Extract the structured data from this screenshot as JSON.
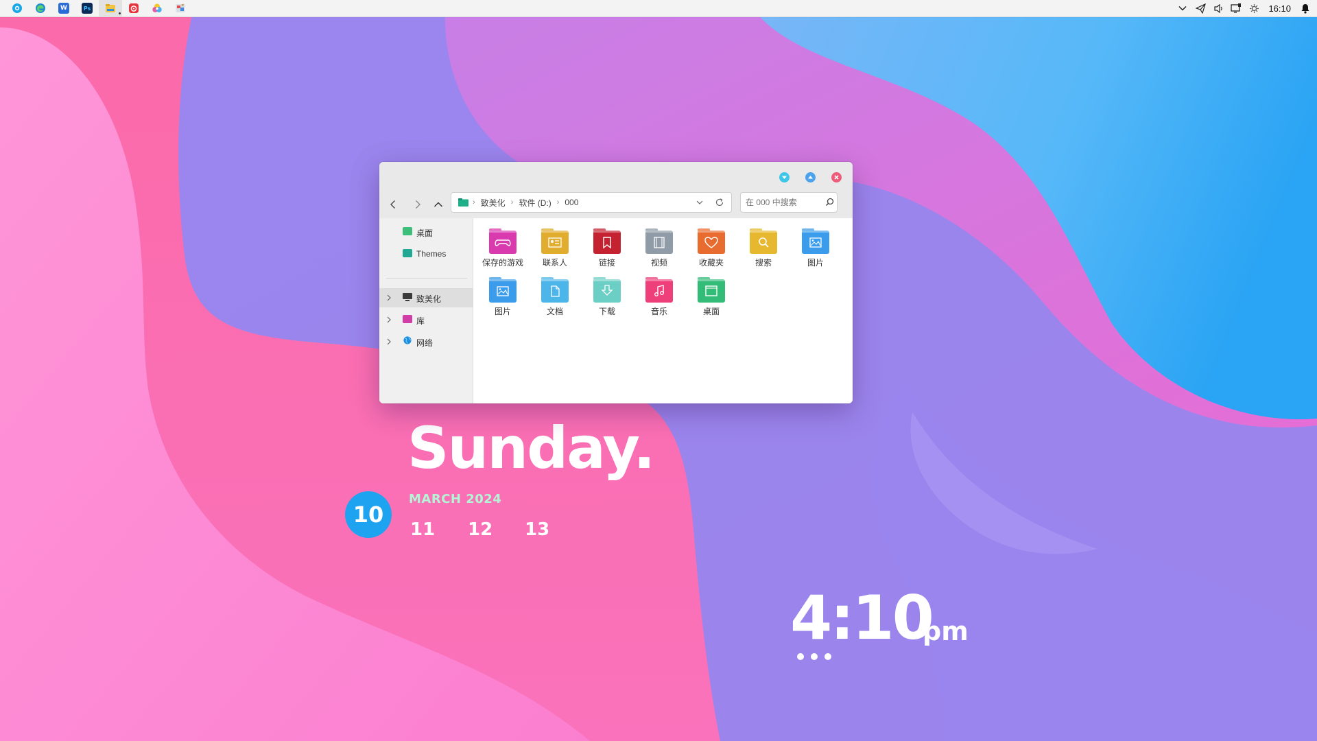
{
  "taskbar": {
    "apps": [
      {
        "name": "360-browser-icon",
        "color": "#1aa7e8"
      },
      {
        "name": "edge-icon",
        "color": "#1d8ad6"
      },
      {
        "name": "word-icon",
        "color": "#2b6bd8",
        "glyph": "W"
      },
      {
        "name": "photoshop-icon",
        "color": "#0b2a55",
        "glyph": "Ps"
      },
      {
        "name": "file-explorer-icon",
        "color": "#f0c340"
      },
      {
        "name": "netease-music-icon",
        "color": "#e8343c"
      },
      {
        "name": "color-picker-icon",
        "color": "#e04e9e"
      },
      {
        "name": "paint-icon",
        "color": "#c78b3c"
      }
    ],
    "clock": "16:10"
  },
  "window": {
    "breadcrumb": [
      "致美化",
      "软件 (D:)",
      "000"
    ],
    "search_placeholder": "在 000 中搜索",
    "sidebar": {
      "quick": [
        {
          "label": "桌面",
          "color": "#3bbf7a"
        },
        {
          "label": "Themes",
          "color": "#1fa892"
        }
      ],
      "tree": [
        {
          "label": "致美化",
          "color": "#3a3a3a"
        },
        {
          "label": "库",
          "color": "#d23ca6"
        },
        {
          "label": "网络",
          "color": "#1e8fe0"
        }
      ]
    },
    "files": [
      {
        "label": "保存的游戏",
        "color": "#d93aae",
        "icon": "gamepad"
      },
      {
        "label": "联系人",
        "color": "#e0ad2e",
        "icon": "contact"
      },
      {
        "label": "链接",
        "color": "#c42230",
        "icon": "bookmark"
      },
      {
        "label": "视频",
        "color": "#8f9ba7",
        "icon": "film"
      },
      {
        "label": "收藏夹",
        "color": "#e86c30",
        "icon": "heart"
      },
      {
        "label": "搜索",
        "color": "#e6b830",
        "icon": "search"
      },
      {
        "label": "图片",
        "color": "#3a9cea",
        "icon": "image"
      },
      {
        "label": "图片",
        "color": "#3a9cea",
        "icon": "image"
      },
      {
        "label": "文档",
        "color": "#4cb6ea",
        "icon": "doc"
      },
      {
        "label": "下载",
        "color": "#6ccfc6",
        "icon": "download"
      },
      {
        "label": "音乐",
        "color": "#ee3f7a",
        "icon": "music"
      },
      {
        "label": "桌面",
        "color": "#33bc78",
        "icon": "desktop"
      }
    ]
  },
  "widget": {
    "day": "Sunday.",
    "date": "10",
    "month_year": "MARCH 2024",
    "next_days": [
      "11",
      "12",
      "13"
    ],
    "time": "4:10",
    "ampm": "pm"
  }
}
